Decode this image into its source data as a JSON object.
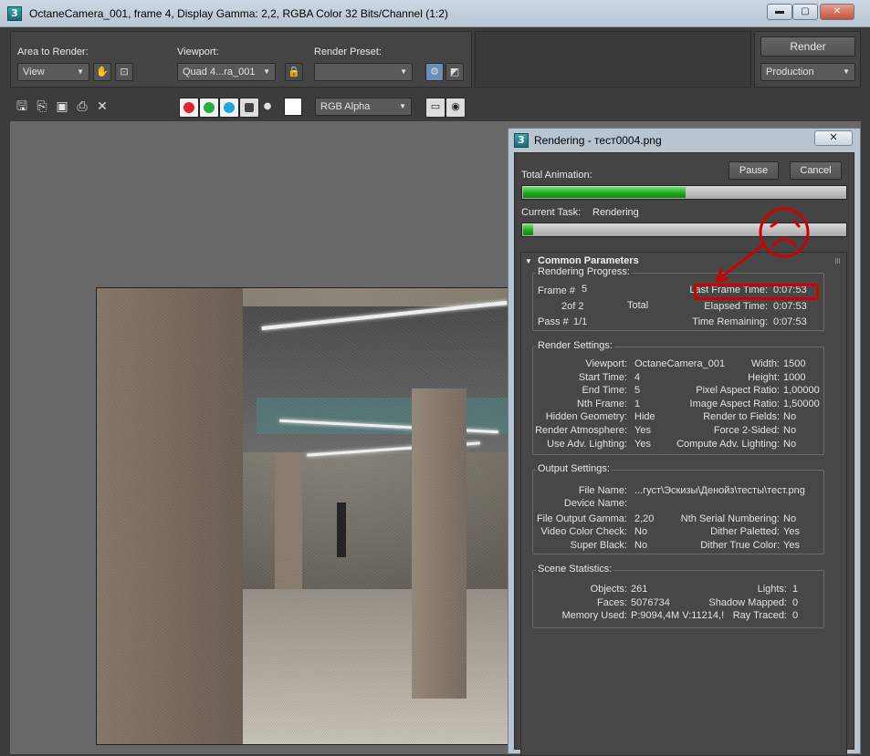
{
  "window": {
    "title": "OctaneCamera_001, frame 4, Display Gamma: 2,2, RGBA Color 32 Bits/Channel (1:2)",
    "app_icon": "3",
    "buttons": {
      "minimize": "▬",
      "maximize": "▢",
      "close": "✕"
    }
  },
  "toolbar": {
    "area_label": "Area to Render:",
    "area_value": "View",
    "viewport_label": "Viewport:",
    "viewport_value": "Quad 4...ra_001",
    "preset_label": "Render Preset:",
    "preset_value": "",
    "render_button": "Render",
    "production_value": "Production",
    "channel_display": "RGB Alpha",
    "icons": [
      "save-icon",
      "copy-icon",
      "clone-icon",
      "print-icon",
      "clear-icon"
    ],
    "channel_colors": {
      "red": "#e0232e",
      "green": "#27b040",
      "blue": "#1fa4de"
    }
  },
  "dialog": {
    "app_icon": "3",
    "title": "Rendering - тест0004.png",
    "close_label": "✕",
    "pause_label": "Pause",
    "cancel_label": "Cancel",
    "total_animation_label": "Total Animation:",
    "total_progress": 0.5,
    "current_task_label": "Current Task:",
    "current_task_value": "Rendering",
    "current_progress": 0.03,
    "rollout_title": "Common Parameters",
    "progress_group": {
      "title": "Rendering Progress:",
      "frame_label": "Frame #",
      "frame_value": "5",
      "count_value": "2of 2",
      "total_label": "Total",
      "pass_label": "Pass #",
      "pass_value": "1/1",
      "last_frame_label": "Last Frame Time:",
      "last_frame_value": "0:07:53",
      "elapsed_label": "Elapsed Time:",
      "elapsed_value": "0:07:53",
      "remaining_label": "Time Remaining:",
      "remaining_value": "0:07:53"
    },
    "render_settings": {
      "title": "Render Settings:",
      "left": [
        {
          "k": "Viewport:",
          "v": "OctaneCamera_001"
        },
        {
          "k": "Start Time:",
          "v": "4"
        },
        {
          "k": "End Time:",
          "v": "5"
        },
        {
          "k": "Nth Frame:",
          "v": "1"
        },
        {
          "k": "Hidden Geometry:",
          "v": "Hide"
        },
        {
          "k": "Render Atmosphere:",
          "v": "Yes"
        },
        {
          "k": "Use Adv. Lighting:",
          "v": "Yes"
        }
      ],
      "right": [
        {
          "k": "Width:",
          "v": "1500"
        },
        {
          "k": "Height:",
          "v": "1000"
        },
        {
          "k": "Pixel Aspect Ratio:",
          "v": "1,00000"
        },
        {
          "k": "Image Aspect Ratio:",
          "v": "1,50000"
        },
        {
          "k": "Render to Fields:",
          "v": "No"
        },
        {
          "k": "Force 2-Sided:",
          "v": "No"
        },
        {
          "k": "Compute Adv. Lighting:",
          "v": "No"
        }
      ]
    },
    "output_settings": {
      "title": "Output Settings:",
      "file_name_label": "File Name:",
      "file_name_value": "...густ\\Эскизы\\Денойз\\тесты\\тест.png",
      "device_label": "Device Name:",
      "device_value": "",
      "left": [
        {
          "k": "File Output Gamma:",
          "v": "2,20"
        },
        {
          "k": "Video Color Check:",
          "v": "No"
        },
        {
          "k": "Super Black:",
          "v": "No"
        }
      ],
      "right": [
        {
          "k": "Nth Serial Numbering:",
          "v": "No"
        },
        {
          "k": "Dither Paletted:",
          "v": "Yes"
        },
        {
          "k": "Dither True Color:",
          "v": "Yes"
        }
      ]
    },
    "scene_statistics": {
      "title": "Scene Statistics:",
      "left": [
        {
          "k": "Objects:",
          "v": "261"
        },
        {
          "k": "Faces:",
          "v": "5076734"
        },
        {
          "k": "Memory Used:",
          "v": "P:9094,4M V:11214,!"
        }
      ],
      "right": [
        {
          "k": "Lights:",
          "v": "1"
        },
        {
          "k": "Shadow Mapped:",
          "v": "0"
        },
        {
          "k": "Ray Traced:",
          "v": "0"
        }
      ]
    }
  },
  "annotation": {
    "color": "#d10000"
  }
}
